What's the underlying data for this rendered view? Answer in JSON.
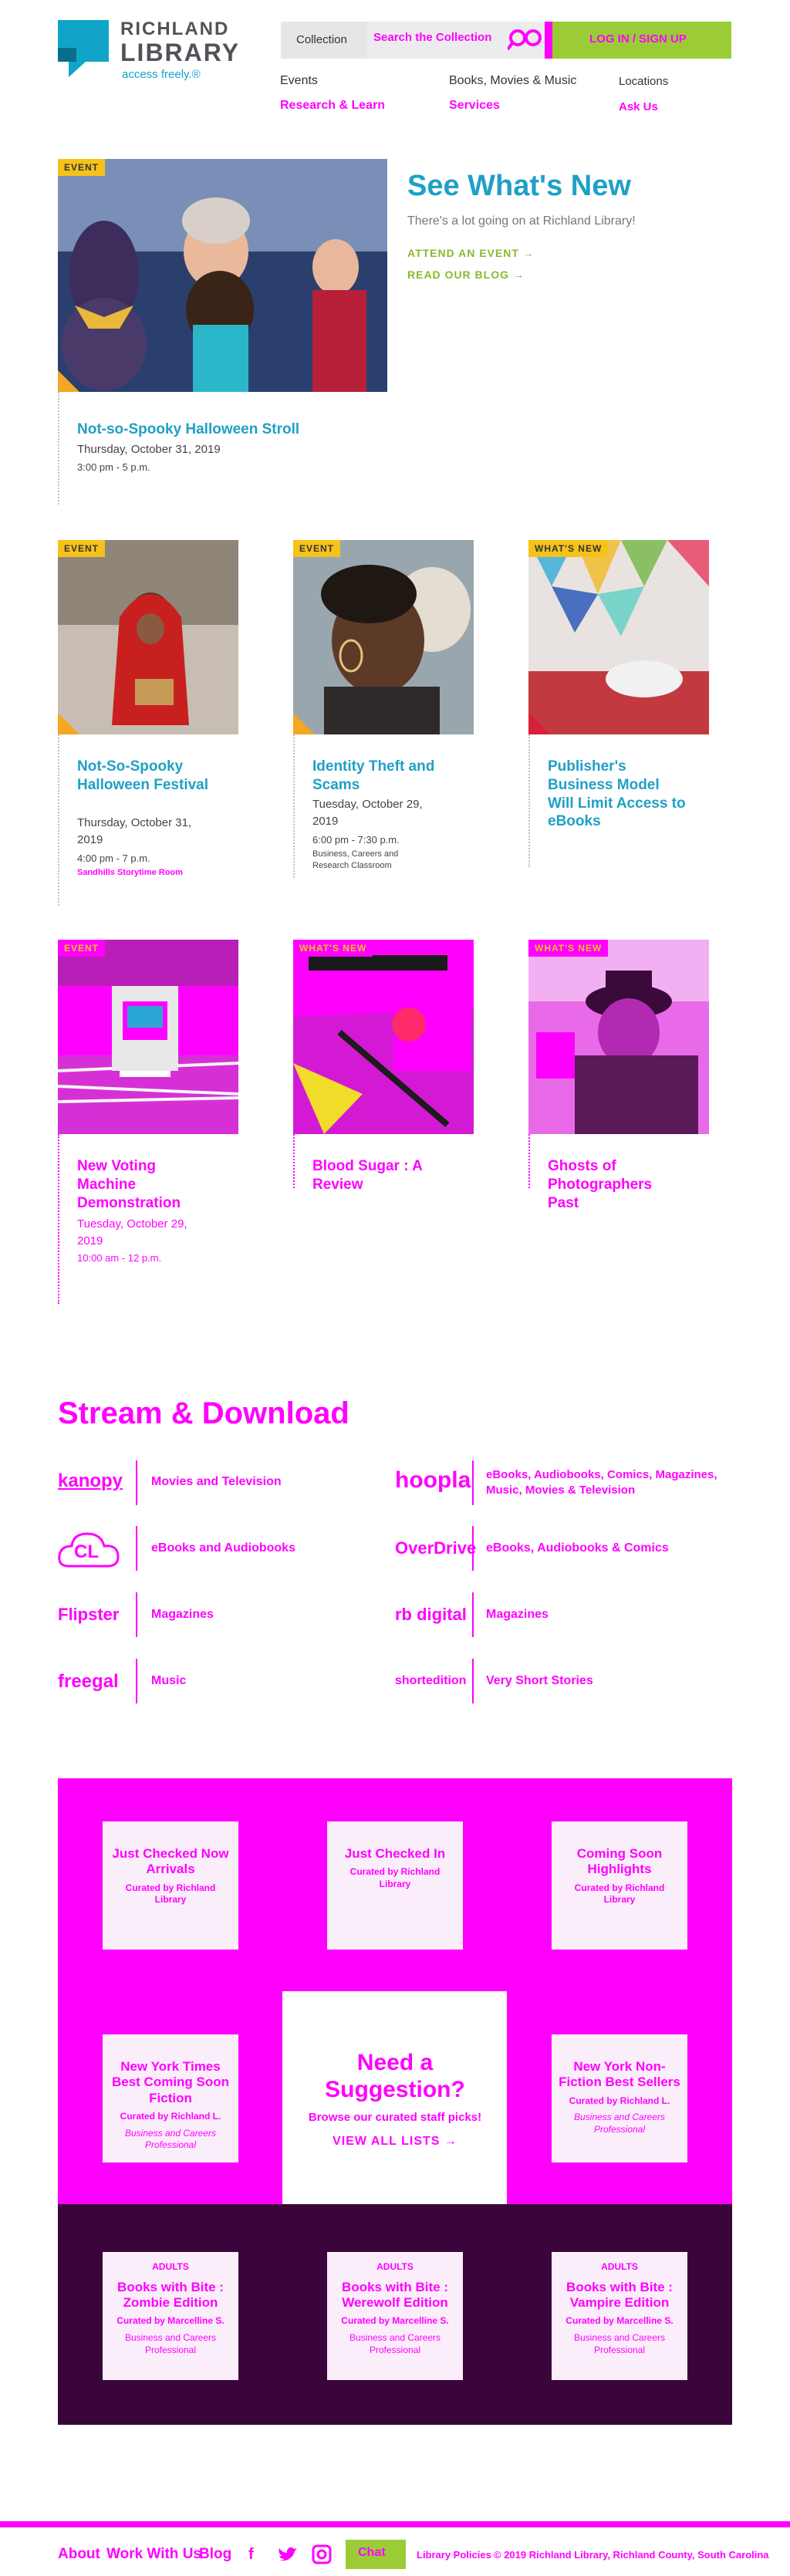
{
  "header": {
    "logo_line1": "RICHLAND",
    "logo_line2": "LIBRARY",
    "tagline": "access freely.®",
    "search_scope": "Collection",
    "search_placeholder": "Search the Collection",
    "login_label": "LOG IN / SIGN UP"
  },
  "nav": {
    "events": "Events",
    "books": "Books, Movies & Music",
    "locations": "Locations",
    "research": "Research & Learn",
    "services": "Services",
    "ask": "Ask Us"
  },
  "feature": {
    "tag": "EVENT",
    "title": "Not-so-Spooky Halloween Stroll",
    "date": "Thursday, October 31, 2019",
    "time": "3:00 pm - 5 p.m.",
    "heading": "See What's New",
    "subheading": "There's a lot going on at Richland Library!",
    "attend_link": "ATTEND AN EVENT →",
    "blog_link": "READ OUR BLOG →"
  },
  "row1": [
    {
      "tag": "EVENT",
      "title": "Not-So-Spooky Halloween Festival",
      "date": "Thursday, October 31, 2019",
      "time": "4:00 pm - 7 p.m.",
      "location": "Sandhills Storytime Room"
    },
    {
      "tag": "EVENT",
      "title": "Identity Theft and Scams",
      "date": "Tuesday, October 29, 2019",
      "time": "6:00 pm - 7:30 p.m.",
      "location": "Business, Careers and Research Classroom"
    },
    {
      "tag": "WHAT'S NEW",
      "title": "Publisher's Business Model Will Limit Access to eBooks",
      "date": "",
      "time": "",
      "location": ""
    }
  ],
  "row2": [
    {
      "tag": "EVENT",
      "title": "New Voting Machine Demonstration",
      "date": "Tuesday, October 29, 2019",
      "time": "10:00 am - 12 p.m."
    },
    {
      "tag": "WHAT'S NEW",
      "title": "Blood Sugar : A Review",
      "date": "",
      "time": ""
    },
    {
      "tag": "WHAT'S NEW",
      "title": "Ghosts of Photographers Past",
      "date": "",
      "time": ""
    }
  ],
  "stream": {
    "title": "Stream & Download",
    "services": [
      {
        "logo": "kanopy",
        "desc": "Movies and Television"
      },
      {
        "logo": "hoopla",
        "desc": "eBooks, Audiobooks, Comics, Magazines, Music, Movies & Television"
      },
      {
        "logo": "CL",
        "desc": "eBooks and Audiobooks"
      },
      {
        "logo": "OverDrive",
        "desc": "eBooks, Audiobooks & Comics"
      },
      {
        "logo": "Flipster",
        "desc": "Magazines"
      },
      {
        "logo": "rb digital",
        "desc": "Magazines"
      },
      {
        "logo": "freegal",
        "desc": "Music"
      },
      {
        "logo": "shortedition",
        "desc": "Very Short Stories"
      }
    ]
  },
  "lists": {
    "cells": [
      {
        "title": "Just Checked Now Arrivals",
        "curator": "Curated by Richland Library",
        "sub": "Richland Library"
      },
      {
        "title": "Just Checked In",
        "curator": "Curated by Richland Library",
        "sub": "Richland Library"
      },
      {
        "title": "Coming Soon Highlights",
        "curator": "Curated by Richland Library",
        "sub": "Richland Library"
      },
      {
        "title": "New York Times Best Coming Soon Fiction",
        "curator": "Curated by Richland L.",
        "sub": "Business and Careers Professional"
      },
      {
        "title": "New York Non-Fiction Best Sellers",
        "curator": "Curated by Richland L.",
        "sub": "Business and Careers Professional"
      },
      {
        "title": "Books with Bite : Zombie Edition",
        "curator": "Curated by Marcelline S.",
        "sub": "Business and Careers Professional"
      },
      {
        "title": "Books with Bite : Werewolf Edition",
        "curator": "Curated by Marcelline S.",
        "sub": "Business and Careers Professional"
      },
      {
        "title": "Books with Bite : Vampire Edition",
        "curator": "Curated by Marcelline S.",
        "sub": "Business and Careers Professional"
      }
    ],
    "badge": "ADULTS",
    "suggest_title": "Need a Suggestion?",
    "suggest_sub": "Browse our curated staff picks!",
    "suggest_link": "VIEW ALL LISTS →"
  },
  "footer": {
    "about": "About",
    "work": "Work With Us",
    "blog": "Blog",
    "chat": "Chat",
    "policies": "Library Policies",
    "copyright": "© 2019 Richland Library, Richland County, South Carolina"
  },
  "colors": {
    "accent": "#1fa0c6",
    "highlight": "#ff00ff",
    "green": "#9bcc36",
    "tag_yellow": "#f5c21a"
  }
}
